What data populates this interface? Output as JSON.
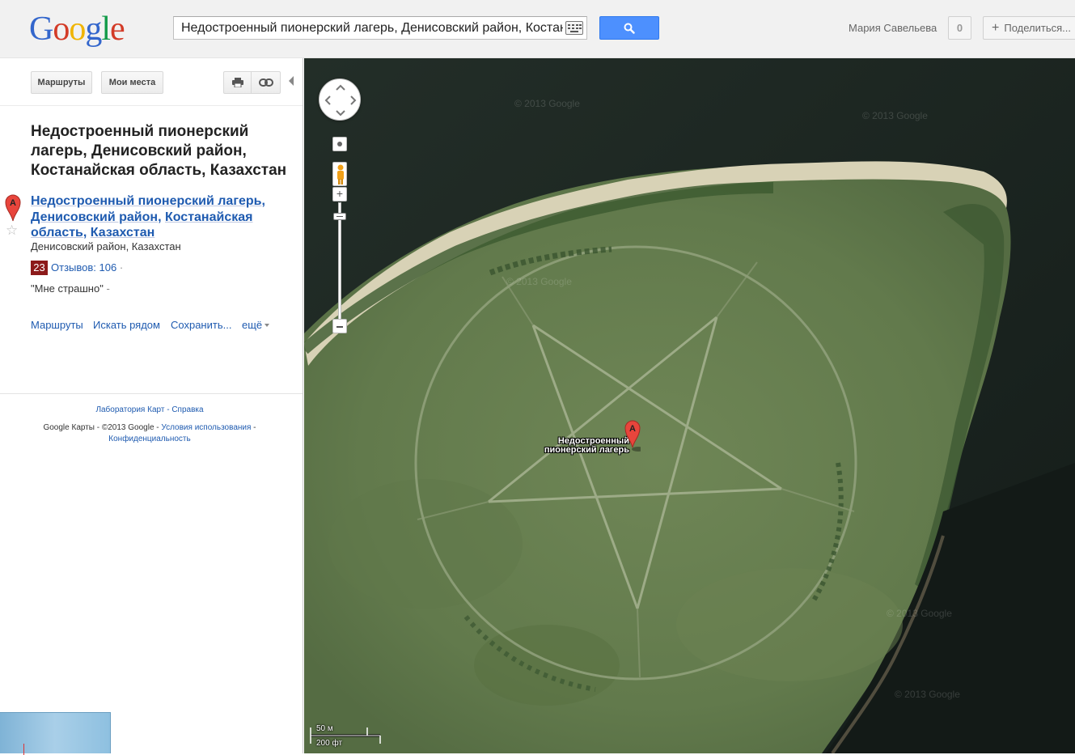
{
  "header": {
    "logo_letters": [
      {
        "ch": "G",
        "color": "#3366cc"
      },
      {
        "ch": "o",
        "color": "#d33b27"
      },
      {
        "ch": "o",
        "color": "#f0b400"
      },
      {
        "ch": "g",
        "color": "#3366cc"
      },
      {
        "ch": "l",
        "color": "#119a48"
      },
      {
        "ch": "e",
        "color": "#d33b27"
      }
    ],
    "search_value": "Недостроенный пионерский лагерь, Денисовский район, Костанайская область, Казахстан",
    "user_name": "Мария Савельева",
    "notification_count": "0",
    "share_label": "Поделиться..."
  },
  "panel": {
    "routes_button": "Маршруты",
    "myplaces_button": "Мои места",
    "title": "Недостроенный пионерский лагерь, Денисовский район, Костанайская область, Казахстан",
    "result": {
      "marker_letter": "A",
      "name_parts": [
        "Недостроенный пионерский лагерь",
        "Денисовский район",
        "Костанайская область",
        "Казахстан"
      ],
      "subtitle": "Денисовский район, Казахстан",
      "rating": "23",
      "reviews_label": "Отзывов:",
      "reviews_count": "106",
      "quote": "\"Мне страшно\""
    },
    "actions": {
      "routes": "Маршруты",
      "nearby": "Искать рядом",
      "save": "Сохранить...",
      "more": "ещё"
    },
    "footer": {
      "lab": "Лаборатория Карт",
      "help": "Справка",
      "copyright": "Google Карты - ©2013 Google",
      "terms": "Условия использования",
      "privacy": "Конфиденциальность"
    }
  },
  "map": {
    "marker_letter": "A",
    "marker_label_line1": "Недостроенный",
    "marker_label_line2": "пионерский лагерь",
    "scale_metric": "50 м",
    "scale_imperial": "200 фт",
    "watermark": "© 2013 Google"
  },
  "colors": {
    "accent_blue": "#4d90fe",
    "link_blue": "#1f5bb0",
    "rating_red": "#8c1a1a",
    "marker_red": "#e8453c"
  }
}
